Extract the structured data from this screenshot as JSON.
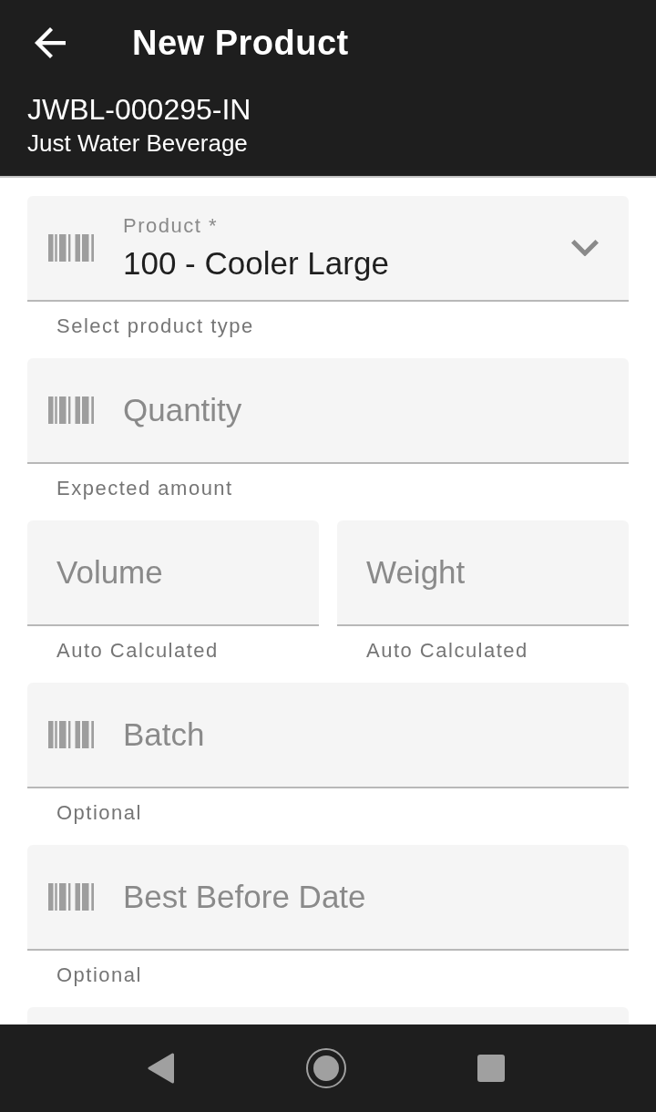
{
  "app_bar": {
    "title": "New Product"
  },
  "subtitle": {
    "reference": "JWBL-000295-IN",
    "name": "Just Water Beverage"
  },
  "rows": [
    {
      "fields": [
        {
          "kind": "select",
          "scan_icon": true,
          "label": "Product *",
          "value": "100 - Cooler Large",
          "helper": "Select product type"
        }
      ]
    },
    {
      "fields": [
        {
          "kind": "input",
          "scan_icon": true,
          "placeholder": "Quantity",
          "helper": "Expected amount"
        }
      ]
    },
    {
      "fields": [
        {
          "kind": "input",
          "scan_icon": false,
          "placeholder": "Volume",
          "helper": "Auto Calculated"
        },
        {
          "kind": "input",
          "scan_icon": false,
          "placeholder": "Weight",
          "helper": "Auto Calculated"
        }
      ]
    },
    {
      "fields": [
        {
          "kind": "input",
          "scan_icon": true,
          "placeholder": "Batch",
          "helper": "Optional"
        }
      ]
    },
    {
      "fields": [
        {
          "kind": "input",
          "scan_icon": true,
          "placeholder": "Best Before Date",
          "helper": "Optional"
        }
      ]
    },
    {
      "fields": [
        {
          "kind": "input",
          "scan_icon": false
        }
      ]
    }
  ]
}
